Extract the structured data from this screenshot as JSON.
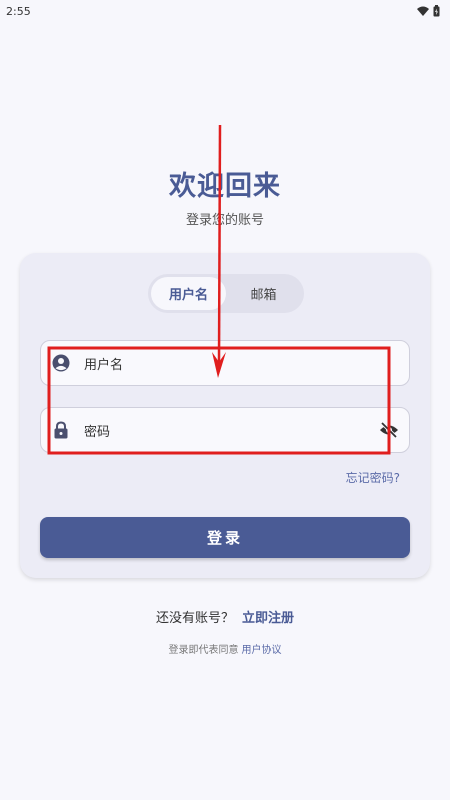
{
  "status_bar": {
    "time": "2:55"
  },
  "header": {
    "title": "欢迎回来",
    "subtitle": "登录您的账号"
  },
  "tabs": [
    {
      "label": "用户名",
      "active": true
    },
    {
      "label": "邮箱",
      "active": false
    }
  ],
  "username_field": {
    "placeholder": "用户名"
  },
  "password_field": {
    "placeholder": "密码"
  },
  "forgot_password": "忘记密码?",
  "login_button": "登录",
  "register": {
    "prompt": "还没有账号？",
    "link": "立即注册"
  },
  "agreement": {
    "text": "登录即代表同意",
    "link": "用户协议"
  },
  "colors": {
    "accent": "#4a5b95",
    "annotation": "#e01e1e"
  }
}
